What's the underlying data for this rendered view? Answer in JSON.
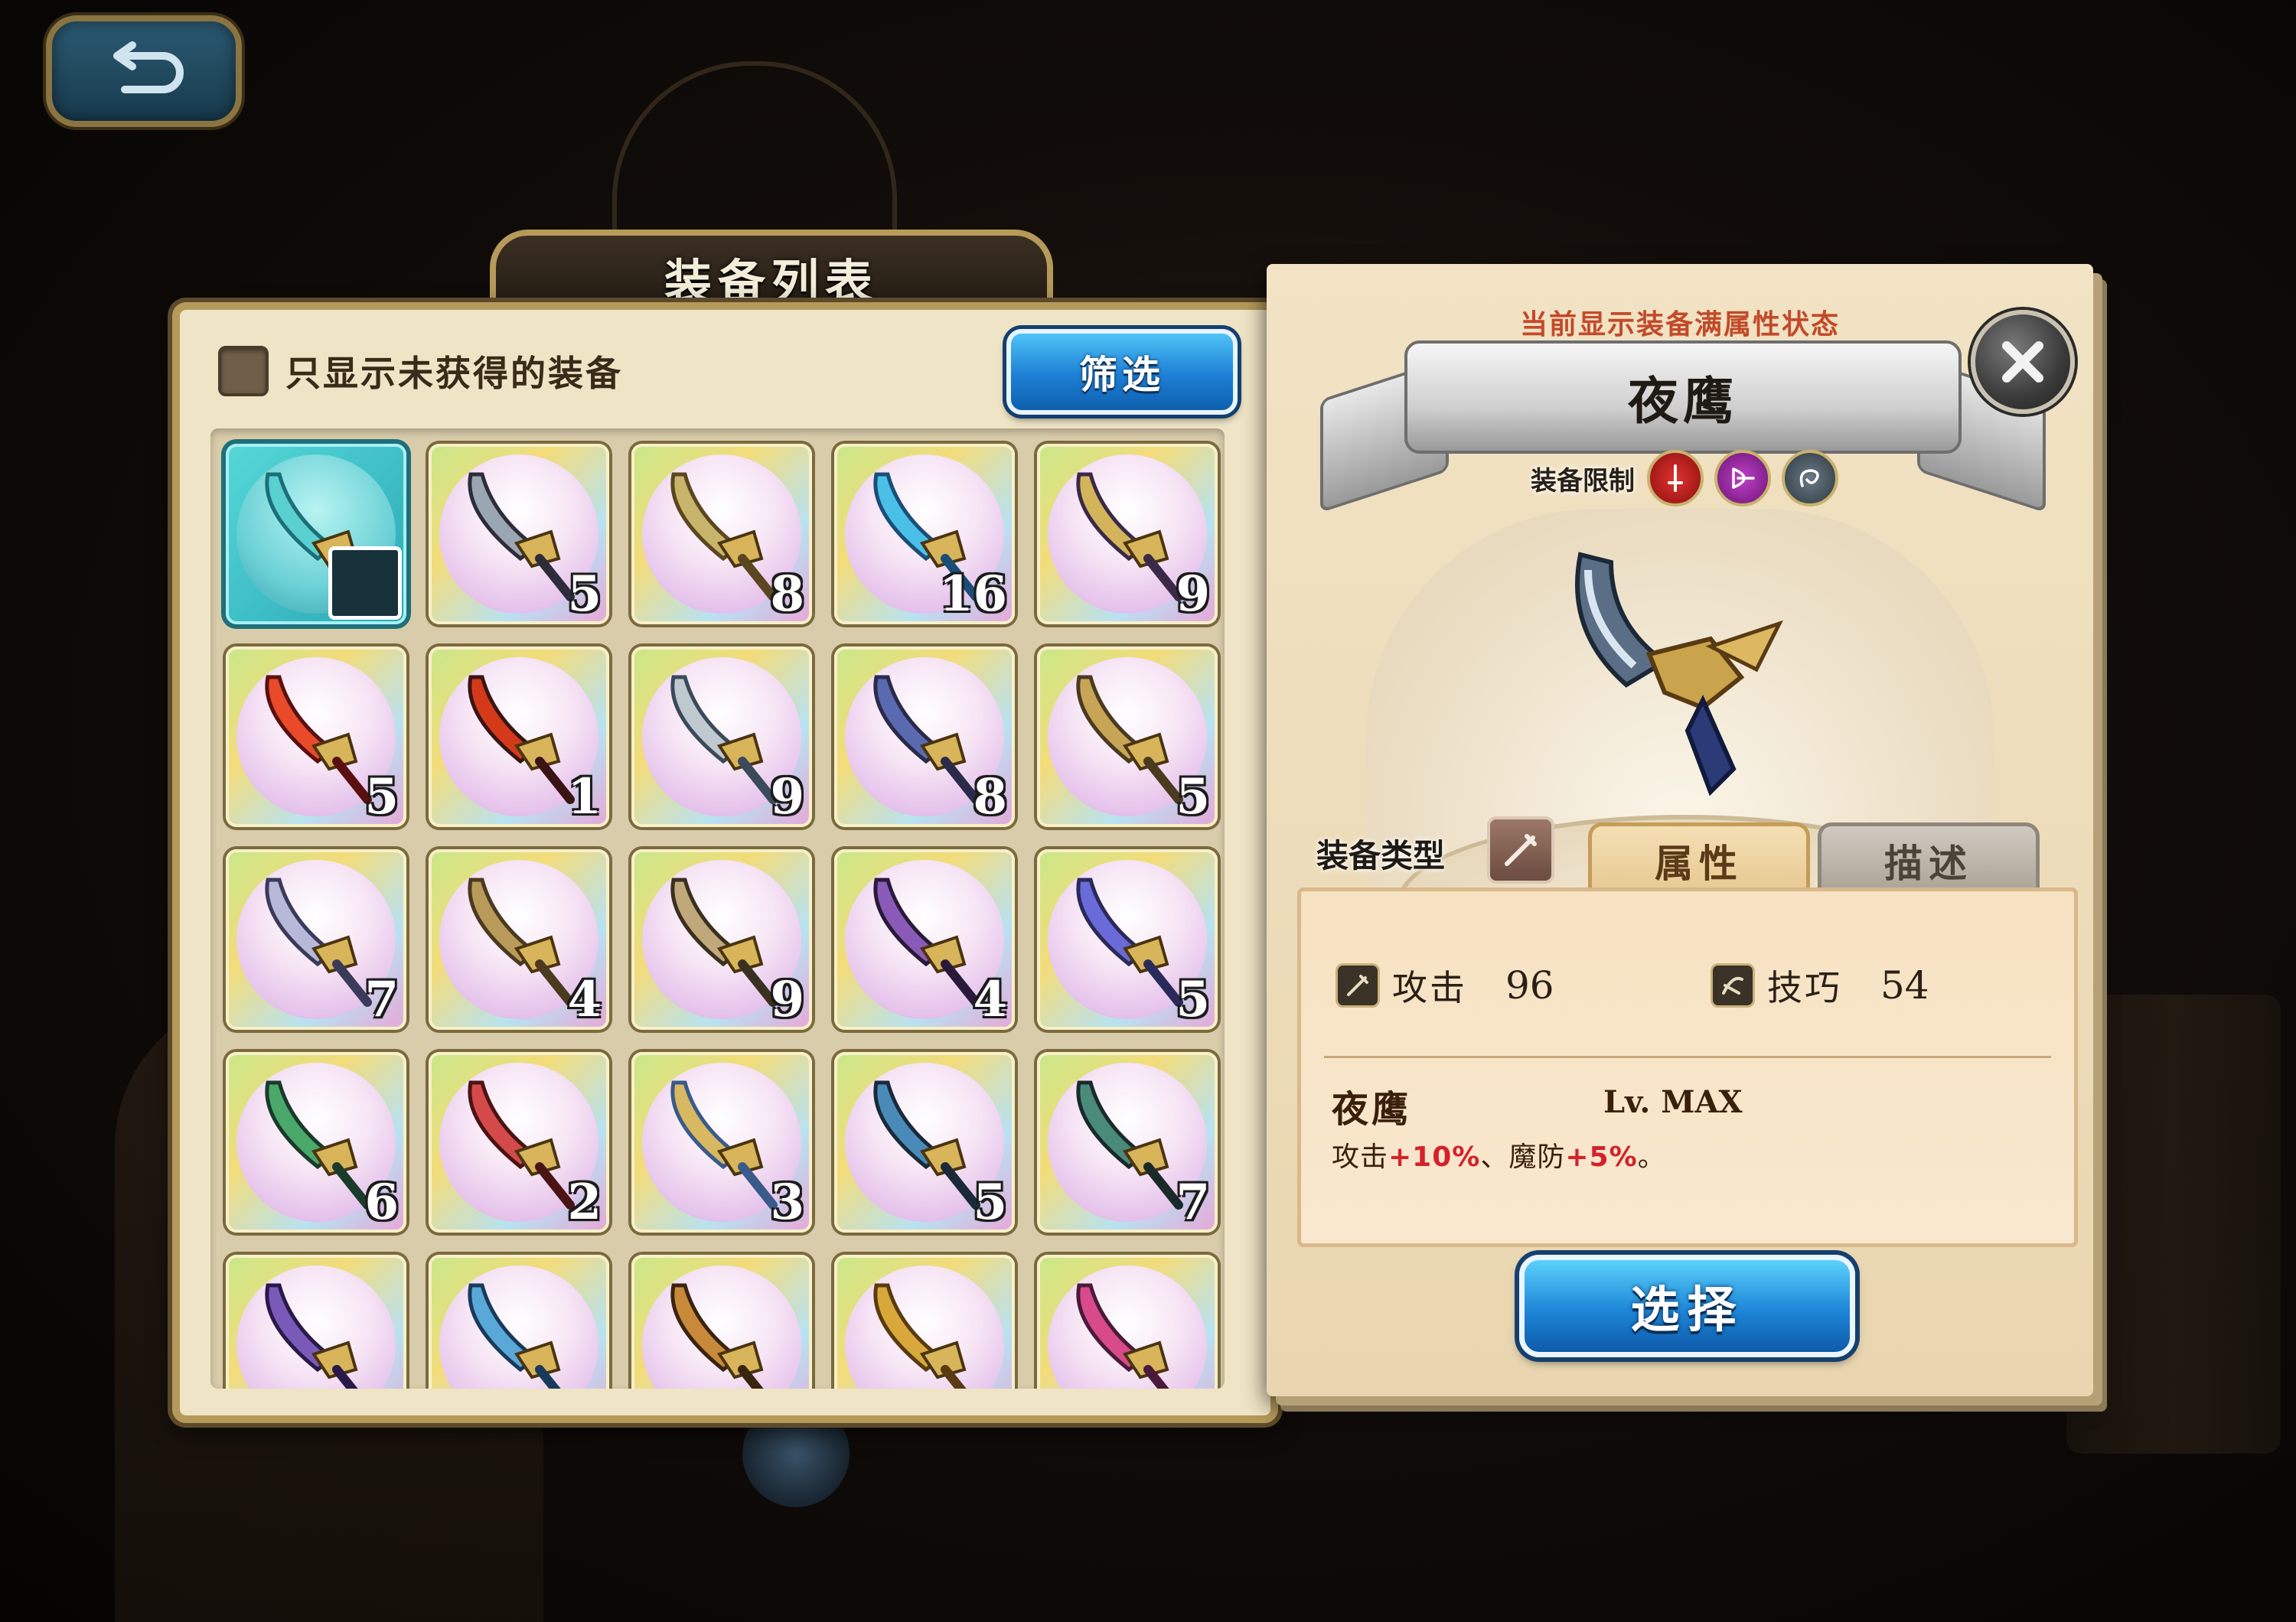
{
  "list_panel": {
    "title": "装备列表",
    "filter_label": "只显示未获得的装备",
    "filter_button": "筛选",
    "items": [
      {
        "name": "blade",
        "count": "",
        "selected": true
      },
      {
        "name": "serrated-dagger",
        "count": "5"
      },
      {
        "name": "curved-dagger",
        "count": "8"
      },
      {
        "name": "crystal-sword",
        "count": "16"
      },
      {
        "name": "winged-dagger",
        "count": "9"
      },
      {
        "name": "flame-sword",
        "count": "5"
      },
      {
        "name": "red-axe",
        "count": "1"
      },
      {
        "name": "battle-axe",
        "count": "9"
      },
      {
        "name": "double-axe",
        "count": "8"
      },
      {
        "name": "war-hammer",
        "count": "5"
      },
      {
        "name": "lightning-hammer",
        "count": "7"
      },
      {
        "name": "great-hammer",
        "count": "4"
      },
      {
        "name": "halberd",
        "count": "9"
      },
      {
        "name": "trident-spear",
        "count": "4"
      },
      {
        "name": "dark-spear",
        "count": "5"
      },
      {
        "name": "vine-staff",
        "count": "6"
      },
      {
        "name": "crimson-staff",
        "count": "2"
      },
      {
        "name": "gold-staff",
        "count": "3"
      },
      {
        "name": "steel-bow",
        "count": "5"
      },
      {
        "name": "dark-bow",
        "count": "7"
      },
      {
        "name": "violet-blade",
        "count": ""
      },
      {
        "name": "azure-blade",
        "count": ""
      },
      {
        "name": "rune-axe",
        "count": ""
      },
      {
        "name": "gilded-mace",
        "count": ""
      },
      {
        "name": "spike-lance",
        "count": ""
      }
    ]
  },
  "detail": {
    "status_note": "当前显示装备满属性状态",
    "name": "夜鹰",
    "restriction_label": "装备限制",
    "type_label": "装备类型",
    "tabs": {
      "attributes": "属性",
      "description": "描述"
    },
    "stats": [
      {
        "name": "攻击",
        "value": "96"
      },
      {
        "name": "技巧",
        "value": "54"
      }
    ],
    "skill": {
      "name": "夜鹰",
      "level": "Lv. MAX",
      "effect_a": "攻击",
      "effect_a_val": "+10%",
      "sep": "、",
      "effect_b": "魔防",
      "effect_b_val": "+5%",
      "end": "。"
    },
    "select_button": "选择"
  }
}
